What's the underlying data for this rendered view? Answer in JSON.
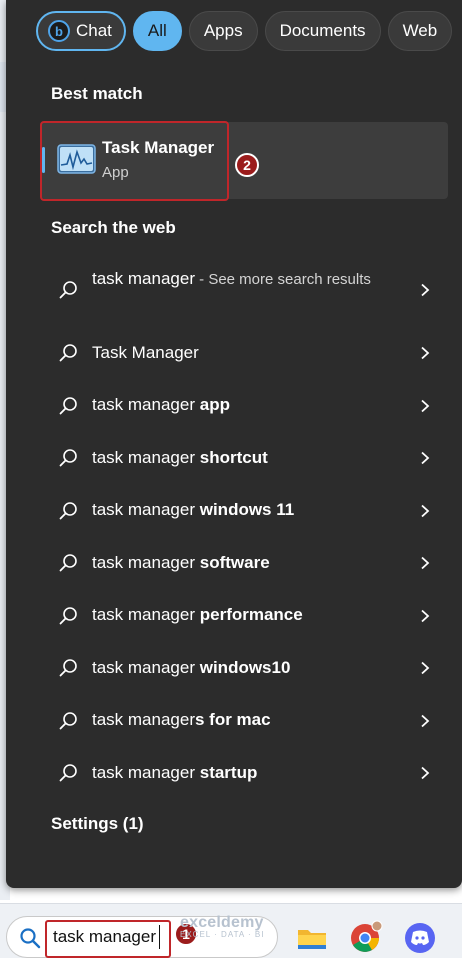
{
  "filters": {
    "chat": "Chat",
    "all": "All",
    "apps": "Apps",
    "documents": "Documents",
    "web": "Web"
  },
  "best_match": {
    "heading": "Best match",
    "app_title": "Task Manager",
    "app_type": "App",
    "step_badge": "2"
  },
  "search_web": {
    "heading": "Search the web",
    "items": [
      {
        "prefix": "task manager",
        "bold": "",
        "more": " - See more search results"
      },
      {
        "prefix": "Task Manager",
        "bold": "",
        "more": ""
      },
      {
        "prefix": "task manager ",
        "bold": "app",
        "more": ""
      },
      {
        "prefix": "task manager ",
        "bold": "shortcut",
        "more": ""
      },
      {
        "prefix": "task manager ",
        "bold": "windows 11",
        "more": ""
      },
      {
        "prefix": "task manager ",
        "bold": "software",
        "more": ""
      },
      {
        "prefix": "task manager ",
        "bold": "performance",
        "more": ""
      },
      {
        "prefix": "task manager ",
        "bold": "windows10",
        "more": ""
      },
      {
        "prefix": "task manager",
        "bold": "s for mac",
        "more": ""
      },
      {
        "prefix": "task manager ",
        "bold": "startup",
        "more": ""
      }
    ]
  },
  "settings": {
    "label": "Settings (1)"
  },
  "taskbar": {
    "search_value": "task manager",
    "step_badge": "1",
    "watermark": "exceldemy",
    "watermark_tag": "EXCEL · DATA · BI",
    "icons": [
      "file-explorer-icon",
      "chrome-icon",
      "discord-icon"
    ]
  },
  "colors": {
    "panel": "#2c2c2c",
    "accent": "#60b6f0",
    "highlight": "#c0262a"
  }
}
